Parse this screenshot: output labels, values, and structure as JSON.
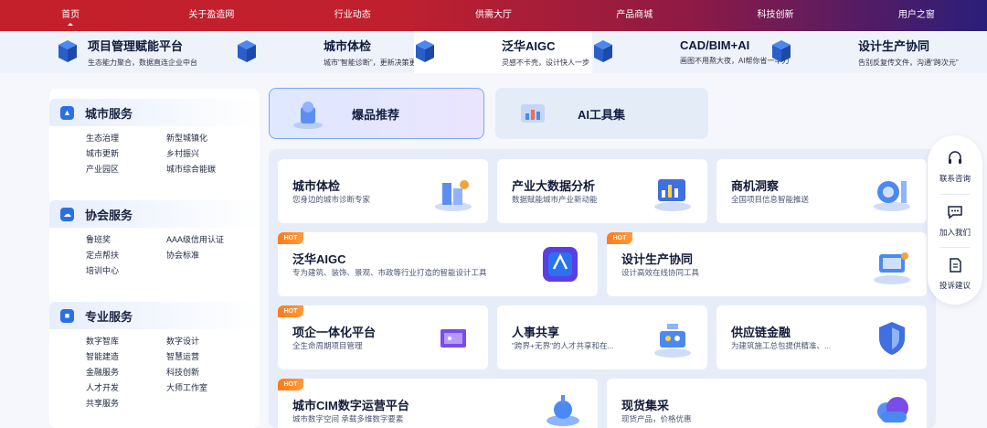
{
  "topnav": {
    "items": [
      "首页",
      "关于盈造网",
      "行业动态",
      "供需大厅",
      "产品商城",
      "科技创新",
      "用户之窗"
    ]
  },
  "subnav": [
    {
      "title": "项目管理赋能平台",
      "desc": "生态能力聚合，数据直连企业中台"
    },
    {
      "title": "城市体检",
      "desc": "城市\"智能诊断\"，更新决策更科学"
    },
    {
      "title": "泛华AIGC",
      "desc": "灵感不卡壳，设计快人一步"
    },
    {
      "title": "CAD/BIM+AI",
      "desc": "画图不用熬大夜，AI帮你省一半力"
    },
    {
      "title": "设计生产协同",
      "desc": "告别反复传文件，沟通\"跨次元\""
    }
  ],
  "sidebar": {
    "sections": [
      {
        "title": "城市服务",
        "links": [
          "生态治理",
          "新型城镇化",
          "城市更新",
          "乡村振兴",
          "产业园区",
          "城市综合能碳"
        ]
      },
      {
        "title": "协会服务",
        "links": [
          "鲁班奖",
          "AAA级信用认证",
          "定点帮扶",
          "协会标准",
          "培训中心"
        ]
      },
      {
        "title": "专业服务",
        "links": [
          "数字智库",
          "数字设计",
          "智能建造",
          "智慧运营",
          "金融服务",
          "科技创新",
          "人才开发",
          "大师工作室",
          "共享服务"
        ]
      }
    ]
  },
  "tabs": [
    "爆品推荐",
    "AI工具集"
  ],
  "hot_label": "HOT",
  "cards": [
    {
      "title": "城市体检",
      "desc": "您身边的城市诊断专家"
    },
    {
      "title": "产业大数据分析",
      "desc": "数据赋能城市产业新动能"
    },
    {
      "title": "商机洞察",
      "desc": "全国项目信息智能推送"
    },
    {
      "title": "泛华AIGC",
      "desc": "专为建筑、装饰、景观、市政等行业打造的智能设计工具"
    },
    {
      "title": "设计生产协同",
      "desc": "设计高效在线协同工具"
    },
    {
      "title": "项企一体化平台",
      "desc": "全生命周期项目管理"
    },
    {
      "title": "人事共享",
      "desc": "\"跨界+无界\"的人才共享和在..."
    },
    {
      "title": "供应链金融",
      "desc": "为建筑施工总包提供精准、..."
    },
    {
      "title": "城市CIM数字运营平台",
      "desc": "城市数字空间 承载多维数字要素"
    },
    {
      "title": "现货集采",
      "desc": "现货产品，价格优惠"
    }
  ],
  "float_panel": [
    "联系咨询",
    "加入我们",
    "投诉建议"
  ],
  "colors": {
    "accent": "#2b6fe6",
    "hot": "#ff7a1a",
    "nav_start": "#c4202c",
    "nav_end": "#2a1e7a"
  }
}
